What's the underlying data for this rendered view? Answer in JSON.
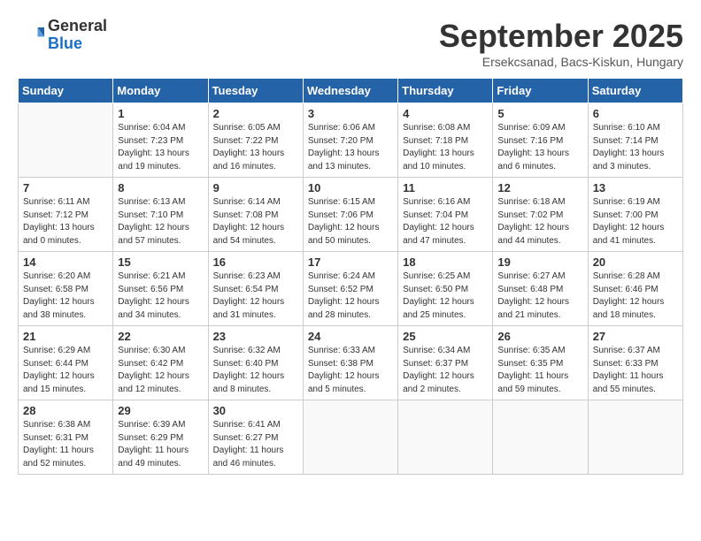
{
  "logo": {
    "general": "General",
    "blue": "Blue"
  },
  "header": {
    "month": "September 2025",
    "location": "Ersekcsanad, Bacs-Kiskun, Hungary"
  },
  "days_of_week": [
    "Sunday",
    "Monday",
    "Tuesday",
    "Wednesday",
    "Thursday",
    "Friday",
    "Saturday"
  ],
  "weeks": [
    [
      {
        "day": "",
        "info": ""
      },
      {
        "day": "1",
        "info": "Sunrise: 6:04 AM\nSunset: 7:23 PM\nDaylight: 13 hours\nand 19 minutes."
      },
      {
        "day": "2",
        "info": "Sunrise: 6:05 AM\nSunset: 7:22 PM\nDaylight: 13 hours\nand 16 minutes."
      },
      {
        "day": "3",
        "info": "Sunrise: 6:06 AM\nSunset: 7:20 PM\nDaylight: 13 hours\nand 13 minutes."
      },
      {
        "day": "4",
        "info": "Sunrise: 6:08 AM\nSunset: 7:18 PM\nDaylight: 13 hours\nand 10 minutes."
      },
      {
        "day": "5",
        "info": "Sunrise: 6:09 AM\nSunset: 7:16 PM\nDaylight: 13 hours\nand 6 minutes."
      },
      {
        "day": "6",
        "info": "Sunrise: 6:10 AM\nSunset: 7:14 PM\nDaylight: 13 hours\nand 3 minutes."
      }
    ],
    [
      {
        "day": "7",
        "info": "Sunrise: 6:11 AM\nSunset: 7:12 PM\nDaylight: 13 hours\nand 0 minutes."
      },
      {
        "day": "8",
        "info": "Sunrise: 6:13 AM\nSunset: 7:10 PM\nDaylight: 12 hours\nand 57 minutes."
      },
      {
        "day": "9",
        "info": "Sunrise: 6:14 AM\nSunset: 7:08 PM\nDaylight: 12 hours\nand 54 minutes."
      },
      {
        "day": "10",
        "info": "Sunrise: 6:15 AM\nSunset: 7:06 PM\nDaylight: 12 hours\nand 50 minutes."
      },
      {
        "day": "11",
        "info": "Sunrise: 6:16 AM\nSunset: 7:04 PM\nDaylight: 12 hours\nand 47 minutes."
      },
      {
        "day": "12",
        "info": "Sunrise: 6:18 AM\nSunset: 7:02 PM\nDaylight: 12 hours\nand 44 minutes."
      },
      {
        "day": "13",
        "info": "Sunrise: 6:19 AM\nSunset: 7:00 PM\nDaylight: 12 hours\nand 41 minutes."
      }
    ],
    [
      {
        "day": "14",
        "info": "Sunrise: 6:20 AM\nSunset: 6:58 PM\nDaylight: 12 hours\nand 38 minutes."
      },
      {
        "day": "15",
        "info": "Sunrise: 6:21 AM\nSunset: 6:56 PM\nDaylight: 12 hours\nand 34 minutes."
      },
      {
        "day": "16",
        "info": "Sunrise: 6:23 AM\nSunset: 6:54 PM\nDaylight: 12 hours\nand 31 minutes."
      },
      {
        "day": "17",
        "info": "Sunrise: 6:24 AM\nSunset: 6:52 PM\nDaylight: 12 hours\nand 28 minutes."
      },
      {
        "day": "18",
        "info": "Sunrise: 6:25 AM\nSunset: 6:50 PM\nDaylight: 12 hours\nand 25 minutes."
      },
      {
        "day": "19",
        "info": "Sunrise: 6:27 AM\nSunset: 6:48 PM\nDaylight: 12 hours\nand 21 minutes."
      },
      {
        "day": "20",
        "info": "Sunrise: 6:28 AM\nSunset: 6:46 PM\nDaylight: 12 hours\nand 18 minutes."
      }
    ],
    [
      {
        "day": "21",
        "info": "Sunrise: 6:29 AM\nSunset: 6:44 PM\nDaylight: 12 hours\nand 15 minutes."
      },
      {
        "day": "22",
        "info": "Sunrise: 6:30 AM\nSunset: 6:42 PM\nDaylight: 12 hours\nand 12 minutes."
      },
      {
        "day": "23",
        "info": "Sunrise: 6:32 AM\nSunset: 6:40 PM\nDaylight: 12 hours\nand 8 minutes."
      },
      {
        "day": "24",
        "info": "Sunrise: 6:33 AM\nSunset: 6:38 PM\nDaylight: 12 hours\nand 5 minutes."
      },
      {
        "day": "25",
        "info": "Sunrise: 6:34 AM\nSunset: 6:37 PM\nDaylight: 12 hours\nand 2 minutes."
      },
      {
        "day": "26",
        "info": "Sunrise: 6:35 AM\nSunset: 6:35 PM\nDaylight: 11 hours\nand 59 minutes."
      },
      {
        "day": "27",
        "info": "Sunrise: 6:37 AM\nSunset: 6:33 PM\nDaylight: 11 hours\nand 55 minutes."
      }
    ],
    [
      {
        "day": "28",
        "info": "Sunrise: 6:38 AM\nSunset: 6:31 PM\nDaylight: 11 hours\nand 52 minutes."
      },
      {
        "day": "29",
        "info": "Sunrise: 6:39 AM\nSunset: 6:29 PM\nDaylight: 11 hours\nand 49 minutes."
      },
      {
        "day": "30",
        "info": "Sunrise: 6:41 AM\nSunset: 6:27 PM\nDaylight: 11 hours\nand 46 minutes."
      },
      {
        "day": "",
        "info": ""
      },
      {
        "day": "",
        "info": ""
      },
      {
        "day": "",
        "info": ""
      },
      {
        "day": "",
        "info": ""
      }
    ]
  ]
}
